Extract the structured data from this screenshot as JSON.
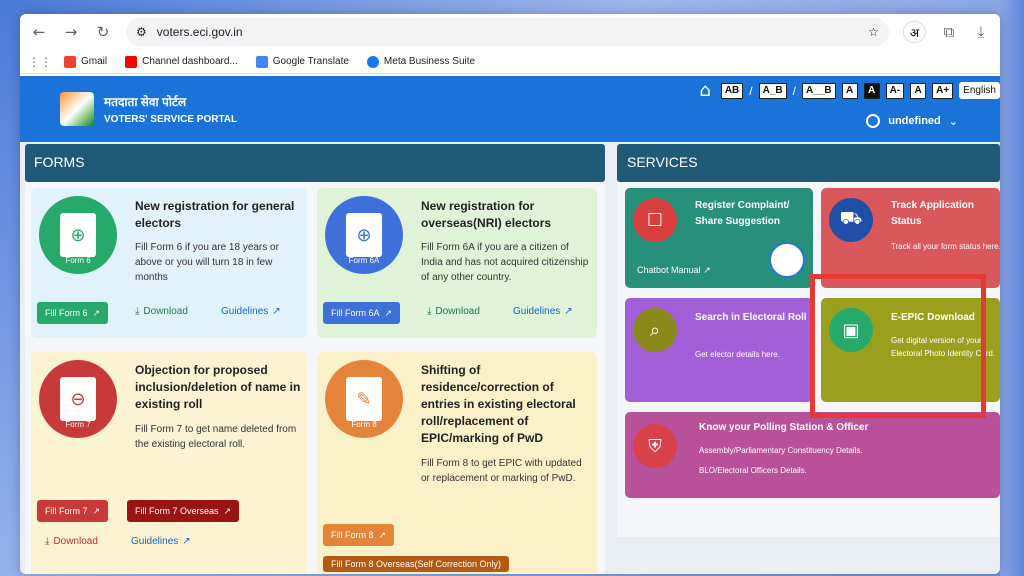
{
  "browser": {
    "url": "voters.eci.gov.in",
    "bookmarks": [
      {
        "label": "Gmail",
        "color": "#ea4335"
      },
      {
        "label": "Channel dashboard...",
        "color": "#ff0000"
      },
      {
        "label": "Google Translate",
        "color": "#4285f4"
      },
      {
        "label": "Meta Business Suite",
        "color": "#1877f2"
      }
    ],
    "translate_chip": "अ"
  },
  "header": {
    "brand_hindi": "मतदाता सेवा पोर्टल",
    "brand_english": "VOTERS' SERVICE PORTAL",
    "tools": [
      "AB",
      "A_B",
      "A__B",
      "A",
      "A",
      "A-",
      "A",
      "A+"
    ],
    "language": "English",
    "user": "undefined"
  },
  "forms": {
    "heading": "FORMS",
    "cards": [
      {
        "title": "New registration for general electors",
        "desc": "Fill Form 6 if you are 18 years or above or you will turn 18 in few months",
        "icon_label": "Form 6",
        "fill_label": "Fill Form 6",
        "download_label": "Download",
        "guidelines_label": "Guidelines"
      },
      {
        "title": "New registration for overseas(NRI) electors",
        "desc": "Fill Form 6A if you are a citizen of India and has not acquired citizenship of any other country.",
        "icon_label": "Form 6A",
        "fill_label": "Fill Form 6A",
        "download_label": "Download",
        "guidelines_label": "Guidelines"
      },
      {
        "title": "Objection for proposed inclusion/deletion of name in existing roll",
        "desc": "Fill Form 7 to get name deleted from the existing electoral roll.",
        "icon_label": "Form 7",
        "fill_label": "Fill Form 7",
        "fill2_label": "Fill Form 7 Overseas",
        "download_label": "Download",
        "guidelines_label": "Guidelines"
      },
      {
        "title": "Shifting of residence/correction of entries in existing electoral roll/replacement of EPIC/marking of PwD",
        "desc": "Fill Form 8 to get EPIC with updated or replacement or marking of PwD.",
        "icon_label": "Form 8",
        "fill_label": "Fill Form 8",
        "fill2_label": "Fill Form 8 Overseas(Self Correction Only)"
      }
    ]
  },
  "services": {
    "heading": "SERVICES",
    "cards": [
      {
        "title": "Register Complaint/ Share Suggestion",
        "desc": "",
        "extra": "Chatbot Manual"
      },
      {
        "title": "Track Application Status",
        "desc": "Track all your form status here."
      },
      {
        "title": "Search in Electoral Roll",
        "desc": "Get elector details here."
      },
      {
        "title": "E-EPIC Download",
        "desc": "Get digital version of your Electoral Photo Identity Card."
      },
      {
        "title": "Know your Polling Station & Officer",
        "desc": "Assembly/Parliamentary Constituency Details.",
        "desc2": "BLO/Electoral Officers Details."
      }
    ]
  }
}
